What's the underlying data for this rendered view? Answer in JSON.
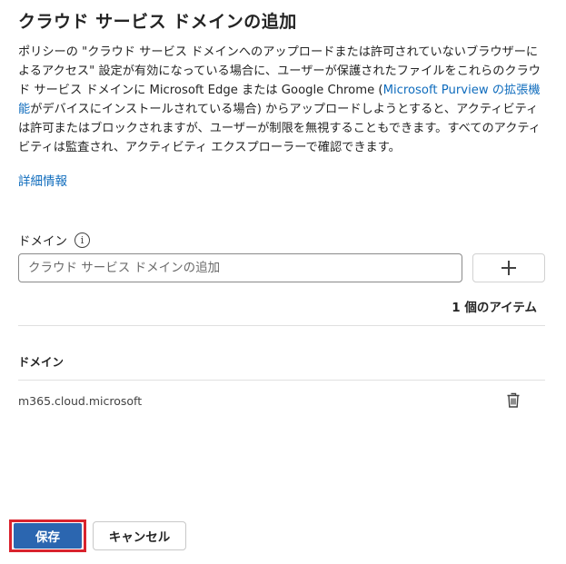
{
  "panel": {
    "title": "クラウド サービス ドメインの追加",
    "description_part1": "ポリシーの \"クラウド サービス ドメインへのアップロードまたは許可されていないブラウザーによるアクセス\" 設定が有効になっている場合に、ユーザーが保護されたファイルをこれらのクラウド サービス ドメインに Microsoft Edge または Google Chrome (",
    "description_link": "Microsoft Purview の拡張機能",
    "description_part2": "がデバイスにインストールされている場合) からアップロードしようとすると、アクティビティは許可またはブロックされますが、ユーザーが制限を無視することもできます。すべてのアクティビティは監査され、アクティビティ エクスプローラーで確認できます。",
    "more_info_link": "詳細情報"
  },
  "domain_field": {
    "label": "ドメイン",
    "info_glyph": "i",
    "placeholder": "クラウド サービス ドメインの追加",
    "add_icon": "plus-icon"
  },
  "list": {
    "item_count": "1 個のアイテム",
    "column_header": "ドメイン",
    "rows": [
      {
        "domain": "m365.cloud.microsoft",
        "action_icon": "trash-icon"
      }
    ]
  },
  "footer": {
    "save_label": "保存",
    "cancel_label": "キャンセル"
  },
  "colors": {
    "link": "#0f6cbd",
    "primary_button": "#2b66b0",
    "highlight_border": "#d9232d"
  }
}
